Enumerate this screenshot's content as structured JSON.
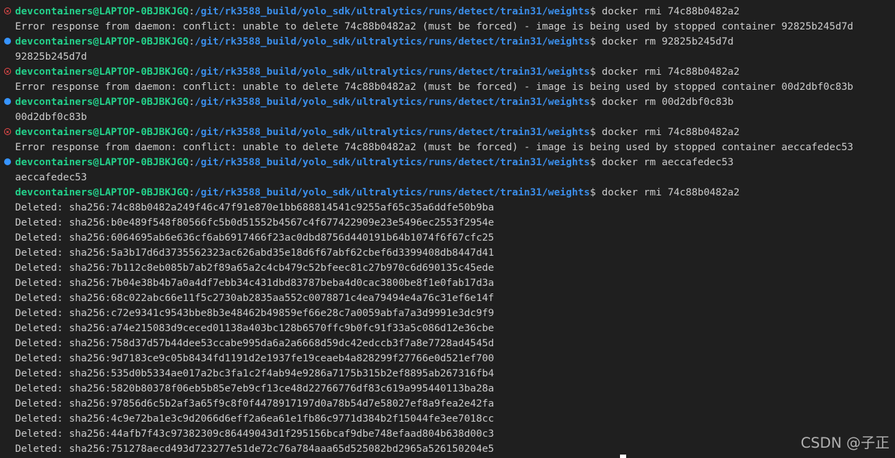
{
  "terminal": {
    "lines": [
      {
        "type": "prompt",
        "status": "error",
        "user": "devcontainers@LAPTOP-0BJBKJGQ",
        "sep": ":",
        "path": "/git/rk3588_build/yolo_sdk/ultralytics/runs/detect/train31/weights",
        "dollar": "$",
        "cmd": " docker rmi 74c88b0482a2"
      },
      {
        "type": "output",
        "text": "Error response from daemon: conflict: unable to delete 74c88b0482a2 (must be forced) - image is being used by stopped container 92825b245d7d"
      },
      {
        "type": "prompt",
        "status": "success",
        "user": "devcontainers@LAPTOP-0BJBKJGQ",
        "sep": ":",
        "path": "/git/rk3588_build/yolo_sdk/ultralytics/runs/detect/train31/weights",
        "dollar": "$",
        "cmd": " docker rm 92825b245d7d"
      },
      {
        "type": "output",
        "text": "92825b245d7d"
      },
      {
        "type": "prompt",
        "status": "error",
        "user": "devcontainers@LAPTOP-0BJBKJGQ",
        "sep": ":",
        "path": "/git/rk3588_build/yolo_sdk/ultralytics/runs/detect/train31/weights",
        "dollar": "$",
        "cmd": " docker rmi 74c88b0482a2"
      },
      {
        "type": "output",
        "text": "Error response from daemon: conflict: unable to delete 74c88b0482a2 (must be forced) - image is being used by stopped container 00d2dbf0c83b"
      },
      {
        "type": "prompt",
        "status": "success",
        "user": "devcontainers@LAPTOP-0BJBKJGQ",
        "sep": ":",
        "path": "/git/rk3588_build/yolo_sdk/ultralytics/runs/detect/train31/weights",
        "dollar": "$",
        "cmd": " docker rm 00d2dbf0c83b"
      },
      {
        "type": "output",
        "text": "00d2dbf0c83b"
      },
      {
        "type": "prompt",
        "status": "error",
        "user": "devcontainers@LAPTOP-0BJBKJGQ",
        "sep": ":",
        "path": "/git/rk3588_build/yolo_sdk/ultralytics/runs/detect/train31/weights",
        "dollar": "$",
        "cmd": " docker rmi 74c88b0482a2"
      },
      {
        "type": "output",
        "text": "Error response from daemon: conflict: unable to delete 74c88b0482a2 (must be forced) - image is being used by stopped container aeccafedec53"
      },
      {
        "type": "prompt",
        "status": "success",
        "user": "devcontainers@LAPTOP-0BJBKJGQ",
        "sep": ":",
        "path": "/git/rk3588_build/yolo_sdk/ultralytics/runs/detect/train31/weights",
        "dollar": "$",
        "cmd": " docker rm aeccafedec53"
      },
      {
        "type": "output",
        "text": "aeccafedec53"
      },
      {
        "type": "prompt",
        "status": "none",
        "user": "devcontainers@LAPTOP-0BJBKJGQ",
        "sep": ":",
        "path": "/git/rk3588_build/yolo_sdk/ultralytics/runs/detect/train31/weights",
        "dollar": "$",
        "cmd": " docker rmi 74c88b0482a2"
      },
      {
        "type": "output",
        "text": "Deleted: sha256:74c88b0482a249f46c47f91e870e1bb688814541c9255af65c35a6ddfe50b9ba"
      },
      {
        "type": "output",
        "text": "Deleted: sha256:b0e489f548f80566fc5b0d51552b4567c4f677422909e23e5496ec2553f2954e"
      },
      {
        "type": "output",
        "text": "Deleted: sha256:6064695ab6e636cf6ab6917466f23ac0dbd8756d440191b64b1074f6f67cfc25"
      },
      {
        "type": "output",
        "text": "Deleted: sha256:5a3b17d6d3735562323ac626abd35e18d6f67abf62cbef6d3399408db8447d41"
      },
      {
        "type": "output",
        "text": "Deleted: sha256:7b112c8eb085b7ab2f89a65a2c4cb479c52bfeec81c27b970c6d690135c45ede"
      },
      {
        "type": "output",
        "text": "Deleted: sha256:7b04e38b4b7a0a4df7ebb34c431dbd83787beba4d0cac3800be8f1e0fab17d3a"
      },
      {
        "type": "output",
        "text": "Deleted: sha256:68c022abc66e11f5c2730ab2835aa552c0078871c4ea79494e4a76c31ef6e14f"
      },
      {
        "type": "output",
        "text": "Deleted: sha256:c72e9341c9543bbe8b3e48462b49859ef66e28c7a0059abfa7a3d9991e3dc9f9"
      },
      {
        "type": "output",
        "text": "Deleted: sha256:a74e215083d9ceced01138a403bc128b6570ffc9b0fc91f33a5c086d12e36cbe"
      },
      {
        "type": "output",
        "text": "Deleted: sha256:758d37d57b44dee53ccabe995da6a2a6668d59dc42edccb3f7a8e7728ad4545d"
      },
      {
        "type": "output",
        "text": "Deleted: sha256:9d7183ce9c05b8434fd1191d2e1937fe19ceaeb4a828299f27766e0d521ef700"
      },
      {
        "type": "output",
        "text": "Deleted: sha256:535d0b5334ae017a2bc3fa1c2f4ab94e9286a7175b315b2ef8895ab267316fb4"
      },
      {
        "type": "output",
        "text": "Deleted: sha256:5820b80378f06eb5b85e7eb9cf13ce48d22766776df83c619a995440113ba28a"
      },
      {
        "type": "output",
        "text": "Deleted: sha256:97856d6c5b2af3a65f9c8f0f4478917197d0a78b54d7e58027ef8a9fea2e42fa"
      },
      {
        "type": "output",
        "text": "Deleted: sha256:4c9e72ba1e3c9d2066d6eff2a6ea61e1fb86c9771d384b2f15044fe3ee7018cc"
      },
      {
        "type": "output",
        "text": "Deleted: sha256:44afb7f43c97382309c86449043d1f295156bcaf9dbe748efaad804b638d00c3"
      },
      {
        "type": "output",
        "text": "Deleted: sha256:751278aecd493d723277e51de72c76a784aaa65d525082bd2965a526150204e5"
      }
    ]
  },
  "watermark": "CSDN @子正",
  "colors": {
    "background": "#1f1f1f",
    "user": "#23d18b",
    "path": "#3b8eea",
    "text": "#cccccc",
    "error_indicator": "#f14c4c",
    "success_indicator": "#3794ff"
  }
}
